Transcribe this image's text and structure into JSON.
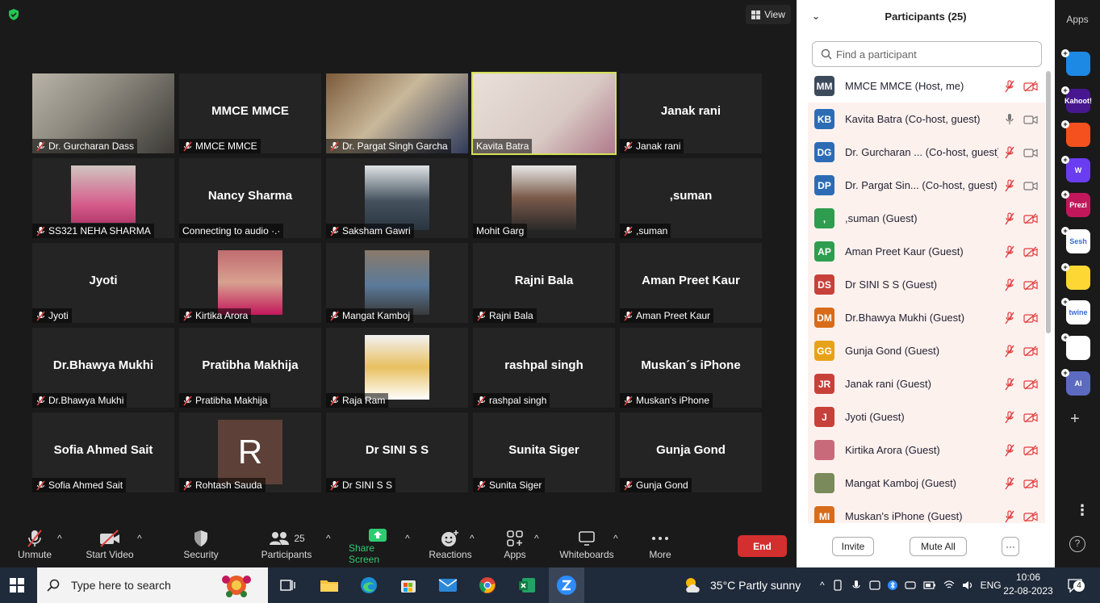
{
  "view_label": "View",
  "tiles": [
    {
      "big": "",
      "cap": "Dr. Gurcharan Dass",
      "muted": true
    },
    {
      "big": "MMCE MMCE",
      "cap": "MMCE MMCE",
      "muted": true
    },
    {
      "big": "",
      "cap": "Dr. Pargat Singh Garcha",
      "muted": true
    },
    {
      "big": "",
      "cap": "Kavita Batra",
      "muted": false
    },
    {
      "big": "Janak rani",
      "cap": "Janak rani",
      "muted": true
    },
    {
      "big": "",
      "cap": "SS321 NEHA SHARMA",
      "muted": true
    },
    {
      "big": "Nancy Sharma",
      "cap": "Connecting to audio ·.·",
      "muted": false
    },
    {
      "big": "",
      "cap": "Saksham Gawri",
      "muted": true
    },
    {
      "big": "",
      "cap": "Mohit Garg",
      "muted": false
    },
    {
      "big": ",suman",
      "cap": ",suman",
      "muted": true
    },
    {
      "big": "Jyoti",
      "cap": "Jyoti",
      "muted": true
    },
    {
      "big": "",
      "cap": "Kirtika Arora",
      "muted": true
    },
    {
      "big": "",
      "cap": "Mangat Kamboj",
      "muted": true
    },
    {
      "big": "Rajni Bala",
      "cap": "Rajni Bala",
      "muted": true
    },
    {
      "big": "Aman Preet Kaur",
      "cap": "Aman Preet Kaur",
      "muted": true
    },
    {
      "big": "Dr.Bhawya Mukhi",
      "cap": "Dr.Bhawya Mukhi",
      "muted": true
    },
    {
      "big": "Pratibha Makhija",
      "cap": "Pratibha Makhija",
      "muted": true
    },
    {
      "big": "",
      "cap": "Raja Ram",
      "muted": true
    },
    {
      "big": "rashpal singh",
      "cap": "rashpal singh",
      "muted": true
    },
    {
      "big": "Muskan´s iPhone",
      "cap": "Muskan's iPhone",
      "muted": true
    },
    {
      "big": "Sofia Ahmed Sait",
      "cap": "Sofia Ahmed Sait",
      "muted": true
    },
    {
      "big": "",
      "cap": "Rohtash Sauda",
      "muted": true
    },
    {
      "big": "Dr SINI S S",
      "cap": "Dr SINI S S",
      "muted": true
    },
    {
      "big": "Sunita Siger",
      "cap": "Sunita Siger",
      "muted": true
    },
    {
      "big": "Gunja Gond",
      "cap": "Gunja Gond",
      "muted": true
    }
  ],
  "rohtash_initial": "R",
  "toolbar": {
    "unmute": "Unmute",
    "start_video": "Start Video",
    "security": "Security",
    "participants": "Participants",
    "participants_count": "25",
    "share_screen": "Share Screen",
    "reactions": "Reactions",
    "apps": "Apps",
    "whiteboards": "Whiteboards",
    "more": "More",
    "end": "End"
  },
  "panel": {
    "title": "Participants (25)",
    "search_placeholder": "Find a participant",
    "invite": "Invite",
    "mute_all": "Mute All",
    "more": "···"
  },
  "participants": [
    {
      "initials": "MM",
      "color": "#3d4a5c",
      "name": "MMCE MMCE (Host, me)",
      "mic": "muted",
      "video": "off"
    },
    {
      "initials": "KB",
      "color": "#2d6cb5",
      "name": "Kavita Batra (Co-host, guest)",
      "mic": "on",
      "video": "on"
    },
    {
      "initials": "DG",
      "color": "#2d6cb5",
      "name": "Dr. Gurcharan ... (Co-host, guest)",
      "mic": "muted",
      "video": "on"
    },
    {
      "initials": "DP",
      "color": "#2d6cb5",
      "name": "Dr. Pargat Sin... (Co-host, guest)",
      "mic": "muted",
      "video": "on"
    },
    {
      "initials": ",",
      "color": "#2f9d4f",
      "name": ",suman (Guest)",
      "mic": "muted",
      "video": "off"
    },
    {
      "initials": "AP",
      "color": "#2f9d4f",
      "name": "Aman Preet Kaur (Guest)",
      "mic": "muted",
      "video": "off"
    },
    {
      "initials": "DS",
      "color": "#c7413a",
      "name": "Dr SINI S S (Guest)",
      "mic": "muted",
      "video": "off"
    },
    {
      "initials": "DM",
      "color": "#d86c1a",
      "name": "Dr.Bhawya Mukhi (Guest)",
      "mic": "muted",
      "video": "off"
    },
    {
      "initials": "GG",
      "color": "#e8a21a",
      "name": "Gunja Gond (Guest)",
      "mic": "muted",
      "video": "off"
    },
    {
      "initials": "JR",
      "color": "#c7413a",
      "name": "Janak rani (Guest)",
      "mic": "muted",
      "video": "off"
    },
    {
      "initials": "J",
      "color": "#c7413a",
      "name": "Jyoti (Guest)",
      "mic": "muted",
      "video": "off"
    },
    {
      "initials": "",
      "color": "#c96a7a",
      "name": "Kirtika Arora (Guest)",
      "mic": "muted",
      "video": "off"
    },
    {
      "initials": "",
      "color": "#7a8a5a",
      "name": "Mangat Kamboj (Guest)",
      "mic": "muted",
      "video": "off"
    },
    {
      "initials": "MI",
      "color": "#d86c1a",
      "name": "Muskan's iPhone (Guest)",
      "mic": "muted",
      "video": "off"
    }
  ],
  "apps_sidebar": {
    "title": "Apps",
    "items": [
      {
        "name": "flowspace-icon",
        "label": "",
        "color": "#1e88e5"
      },
      {
        "name": "kahoot-icon",
        "label": "Kahoot!",
        "color": "#46178f"
      },
      {
        "name": "slides-icon",
        "label": "",
        "color": "#f4511e"
      },
      {
        "name": "wooclap-icon",
        "label": "W",
        "color": "#6a3df0"
      },
      {
        "name": "prezi-icon",
        "label": "Prezi",
        "color": "#c2185b"
      },
      {
        "name": "sesh-icon",
        "label": "Sesh",
        "color": "#ffffff"
      },
      {
        "name": "emoji-app-icon",
        "label": "",
        "color": "#fdd835"
      },
      {
        "name": "twine-icon",
        "label": "twine",
        "color": "#ffffff"
      },
      {
        "name": "grid-app-icon",
        "label": "",
        "color": "#ffffff"
      },
      {
        "name": "ai-app-icon",
        "label": "AI",
        "color": "#5c6bc0"
      }
    ]
  },
  "taskbar": {
    "search_placeholder": "Type here to search",
    "weather": "35°C  Partly sunny",
    "lang": "ENG",
    "time": "10:06",
    "date": "22-08-2023",
    "notifications": "4"
  }
}
